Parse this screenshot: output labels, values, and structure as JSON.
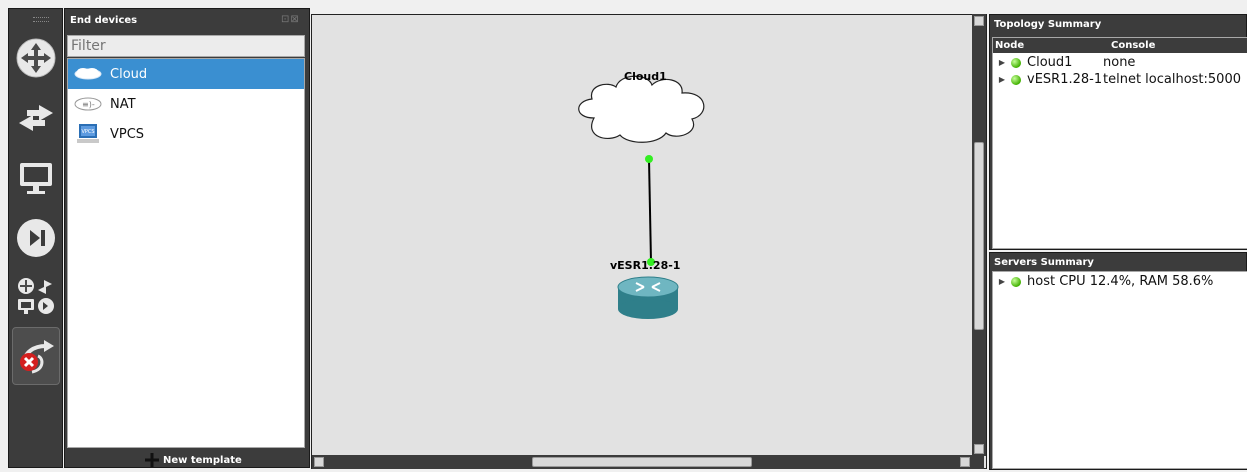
{
  "end_devices": {
    "title": "End devices",
    "filter_placeholder": "Filter",
    "items": [
      {
        "label": "Cloud",
        "icon": "cloud-icon",
        "selected": true
      },
      {
        "label": "NAT",
        "icon": "nat-icon",
        "selected": false
      },
      {
        "label": "VPCS",
        "icon": "vpcs-icon",
        "selected": false
      }
    ],
    "new_template_label": "New template"
  },
  "toolbar": {
    "items": [
      {
        "icon": "routers-icon"
      },
      {
        "icon": "switches-icon"
      },
      {
        "icon": "end-devices-icon"
      },
      {
        "icon": "security-devices-icon"
      },
      {
        "icon": "all-devices-icon"
      },
      {
        "icon": "add-link-icon"
      }
    ]
  },
  "topology": {
    "nodes": [
      {
        "name": "Cloud1",
        "type": "cloud"
      },
      {
        "name": "vESR1.28-1",
        "type": "router"
      }
    ],
    "link_status_color": "#33ee22"
  },
  "topology_summary": {
    "title": "Topology Summary",
    "columns": [
      "Node",
      "Console"
    ],
    "rows": [
      {
        "node": "Cloud1",
        "console": "none",
        "status_color": "#41b000"
      },
      {
        "node": "vESR1.28-1",
        "console": "telnet localhost:5000",
        "status_color": "#41b000"
      }
    ]
  },
  "servers_summary": {
    "title": "Servers Summary",
    "rows": [
      {
        "text": "host CPU 12.4%, RAM 58.6%",
        "status_color": "#41b000"
      }
    ]
  }
}
